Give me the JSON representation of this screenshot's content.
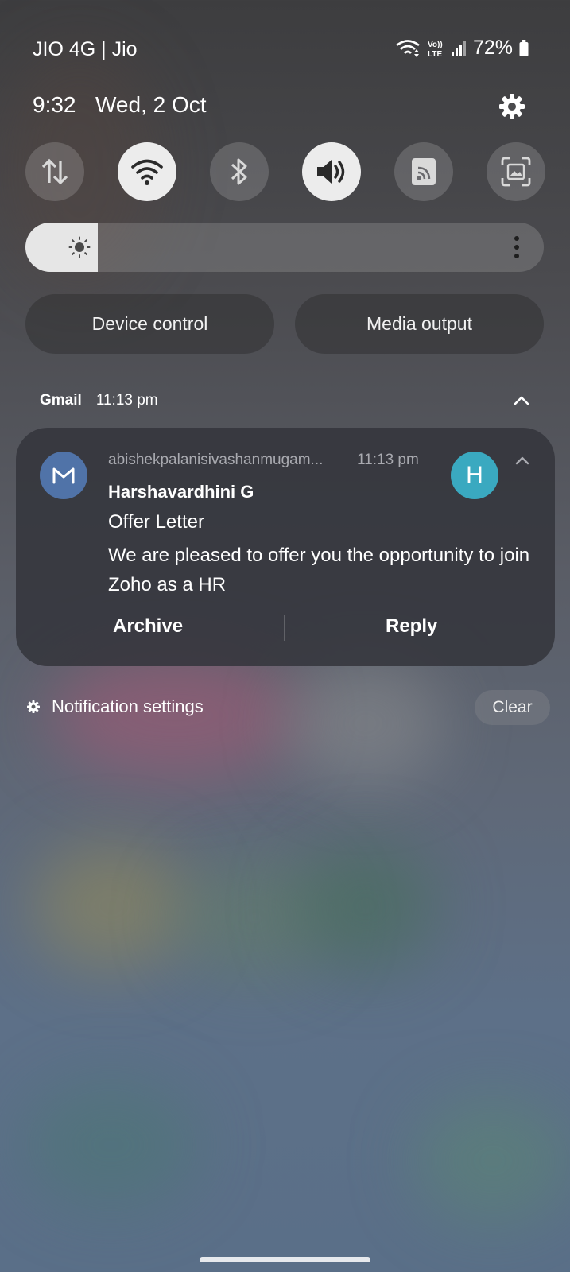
{
  "status_bar": {
    "carrier": "JIO 4G | Jio",
    "battery_percent": "72%",
    "volte_label": "Vo)) LTE",
    "time": "9:32",
    "date": "Wed, 2 Oct"
  },
  "quick_settings": {
    "tiles": [
      {
        "name": "mobile-data",
        "icon": "data-arrows-icon",
        "on": false
      },
      {
        "name": "wifi",
        "icon": "wifi-icon",
        "on": true
      },
      {
        "name": "bluetooth",
        "icon": "bluetooth-icon",
        "on": false
      },
      {
        "name": "sound",
        "icon": "speaker-icon",
        "on": true
      },
      {
        "name": "cast",
        "icon": "cast-icon",
        "on": false
      },
      {
        "name": "screen-capture",
        "icon": "screen-capture-icon",
        "on": false
      }
    ],
    "brightness_level": 0.14,
    "device_control_label": "Device control",
    "media_output_label": "Media output"
  },
  "notification_group": {
    "app_name": "Gmail",
    "time": "11:13 pm"
  },
  "notification": {
    "sender_email": "abishekpalanisivashanmugam...",
    "time": "11:13 pm",
    "avatar_letter": "H",
    "sender_name": "Harshavardhini G",
    "subject": "Offer Letter",
    "body": "We are pleased to offer you the opportunity to join Zoho as a HR",
    "archive_label": "Archive",
    "reply_label": "Reply"
  },
  "footer": {
    "notification_settings_label": "Notification settings",
    "clear_label": "Clear"
  },
  "colors": {
    "gmail_icon_bg": "#5073a8",
    "avatar_bg": "#3aa9c0",
    "tile_on": "#ececec"
  }
}
